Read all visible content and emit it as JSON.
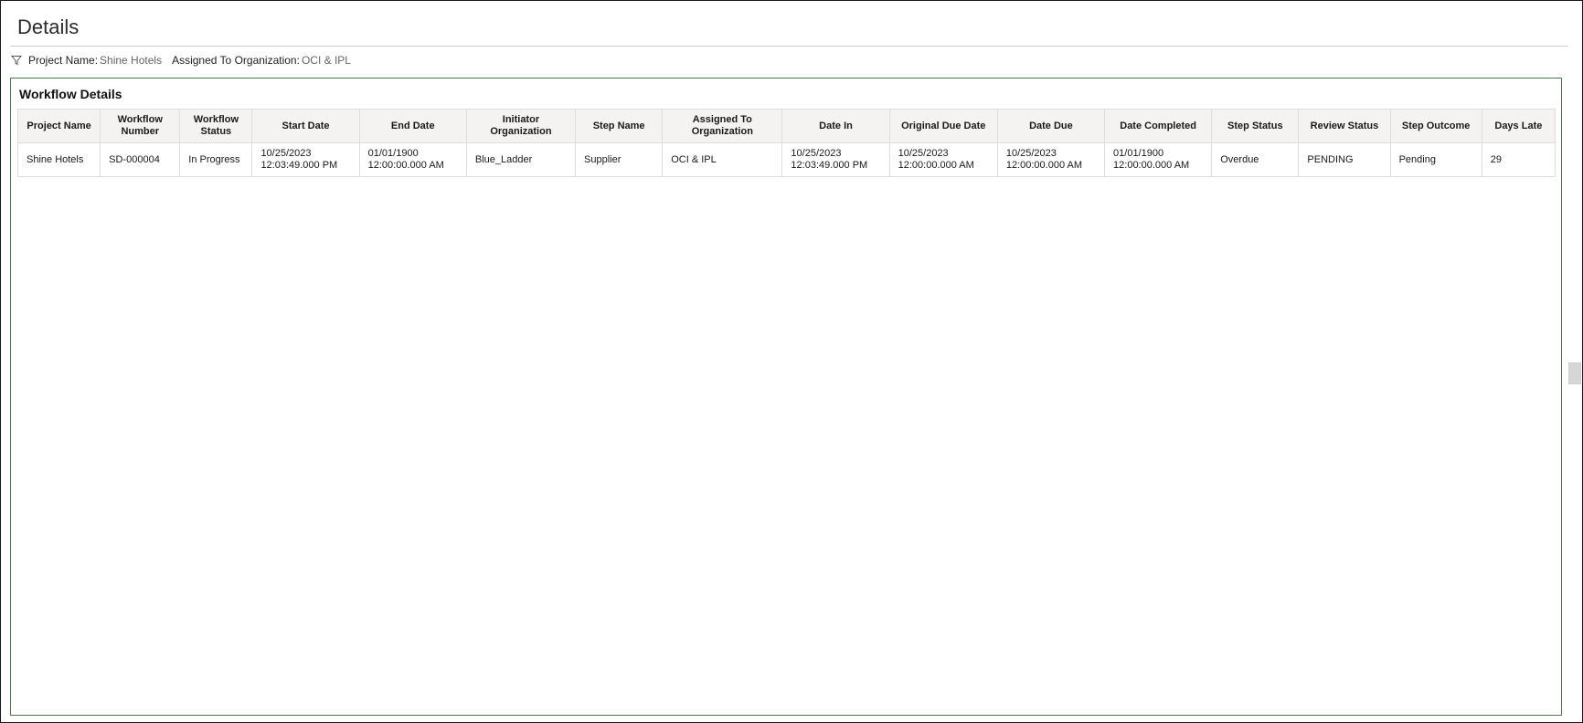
{
  "page": {
    "title": "Details"
  },
  "filters": [
    {
      "label": "Project Name:",
      "value": "Shine Hotels"
    },
    {
      "label": "Assigned To Organization:",
      "value": "OCI & IPL"
    }
  ],
  "panel": {
    "title": "Workflow Details"
  },
  "table": {
    "columns": [
      [
        "Project Name"
      ],
      [
        "Workflow",
        "Number"
      ],
      [
        "Workflow",
        "Status"
      ],
      [
        "Start Date"
      ],
      [
        "End Date"
      ],
      [
        "Initiator",
        "Organization"
      ],
      [
        "Step Name"
      ],
      [
        "Assigned To",
        "Organization"
      ],
      [
        "Date In"
      ],
      [
        "Original Due Date"
      ],
      [
        "Date Due"
      ],
      [
        "Date Completed"
      ],
      [
        "Step Status"
      ],
      [
        "Review Status"
      ],
      [
        "Step Outcome"
      ],
      [
        "Days Late"
      ]
    ],
    "rows": [
      [
        [
          "Shine Hotels"
        ],
        [
          "SD-000004"
        ],
        [
          "In Progress"
        ],
        [
          "10/25/2023",
          "12:03:49.000 PM"
        ],
        [
          "01/01/1900",
          "12:00:00.000 AM"
        ],
        [
          "Blue_Ladder"
        ],
        [
          "Supplier"
        ],
        [
          "OCI & IPL"
        ],
        [
          "10/25/2023",
          "12:03:49.000 PM"
        ],
        [
          "10/25/2023",
          "12:00:00.000 AM"
        ],
        [
          "10/25/2023",
          "12:00:00.000 AM"
        ],
        [
          "01/01/1900",
          "12:00:00.000 AM"
        ],
        [
          "Overdue"
        ],
        [
          "PENDING"
        ],
        [
          "Pending"
        ],
        [
          "29"
        ]
      ]
    ]
  },
  "icons": {
    "filter": "filter-funnel-icon"
  },
  "colors": {
    "panel_border": "#4f7a4f",
    "header_bg": "#f4f3f1"
  }
}
